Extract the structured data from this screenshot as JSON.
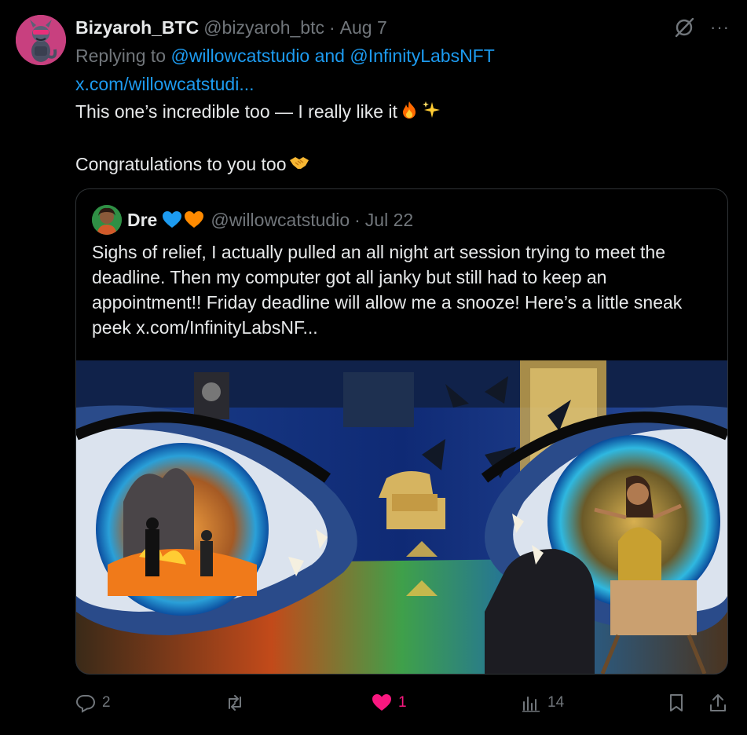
{
  "post": {
    "display_name": "Bizyaroh_BTC",
    "handle": "@bizyaroh_btc",
    "separator": "·",
    "date": "Aug 7",
    "replying_prefix": "Replying to ",
    "replying_mentions": "@willowcatstudio and @InfinityLabsNFT",
    "link": "x.com/willowcatstudi...",
    "line1": "This one’s incredible too — I really like it",
    "line2": "Congratulations to you too",
    "more_label": "···",
    "icons": {
      "avatar": "dragon-avatar",
      "grok": "grok-icon",
      "more": "more-icon",
      "fire": "fire-emoji",
      "sparkles": "sparkles-emoji",
      "handshake": "handshake-emoji"
    }
  },
  "quote": {
    "display_name": "Dre",
    "handle": "@willowcatstudio",
    "separator": "·",
    "date": "Jul 22",
    "text": "Sighs of relief, I actually pulled an all night art session trying to meet the deadline. Then my computer got all janky but still had to keep an appointment!! Friday deadline will allow me a snooze! Here’s a little sneak peek  x.com/InfinityLabsNF...",
    "heart_colors": [
      "#1d9bf0",
      "#ff8a00"
    ],
    "image": "surreal-eyes-artwork"
  },
  "actions": {
    "replies": "2",
    "reposts": "",
    "likes": "1",
    "views": "14"
  },
  "colors": {
    "accent": "#1d9bf0",
    "like": "#f91880",
    "muted": "#71767b",
    "text": "#e7e9ea",
    "background": "#000000"
  }
}
